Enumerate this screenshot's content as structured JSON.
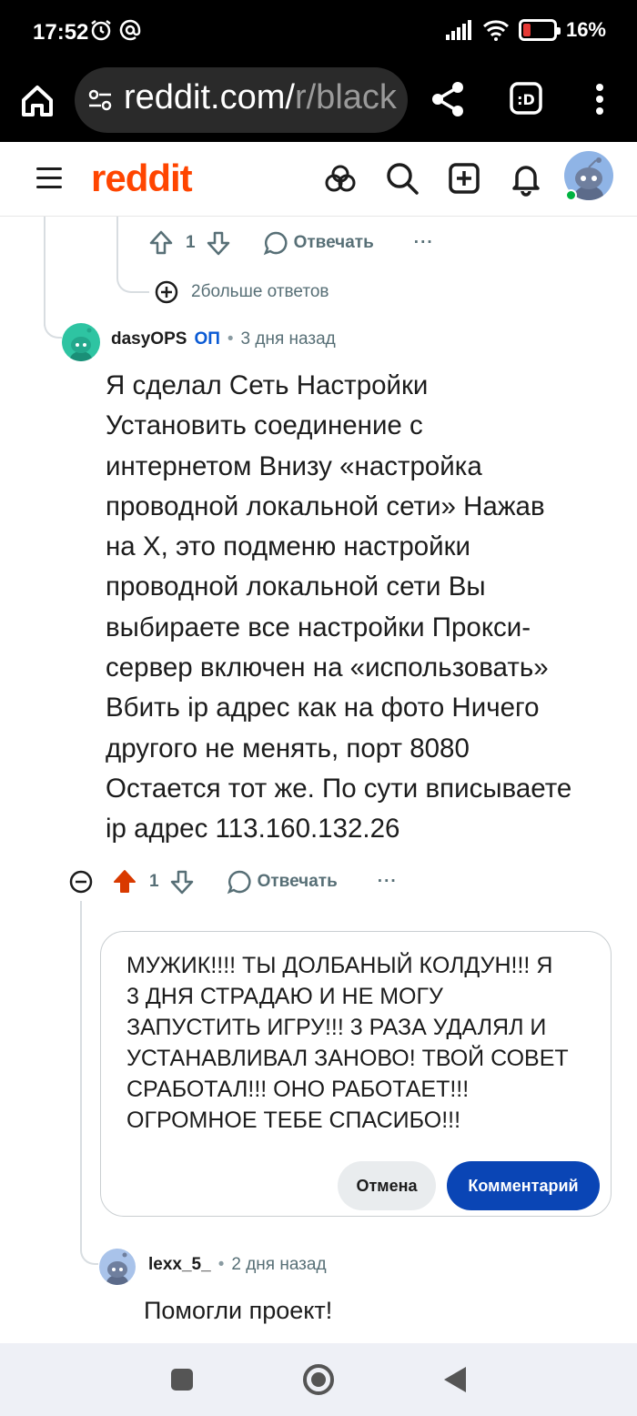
{
  "status": {
    "time": "17:52",
    "battery": "16%",
    "battery_level": 0.16
  },
  "browser": {
    "url_main": "reddit.com/",
    "url_dim": "r/black"
  },
  "header": {
    "logo": "reddit"
  },
  "prev_comment": {
    "votes": "1",
    "reply_label": "Отвечать",
    "more": "···",
    "more_replies": "2больше ответов"
  },
  "comment": {
    "author": "dasyOPS",
    "op_badge": "ОП",
    "separator": "•",
    "time": "3 дня назад",
    "lines": [
      "Я сделал Сеть  Настройки",
      "Установить соединение с",
      "интернетом Внизу «настройка",
      "проводной локальной сети» Нажав",
      "на Х, это подменю настройки",
      "проводной локальной сети Вы",
      "выбираете все настройки Прокси-",
      "сервер включен на «использовать»",
      "Вбить ip адрес как на фото Ничего",
      "другого не менять, порт 8080",
      "Остается тот же. По сути вписываете",
      "ip адрес 113.160.132.26"
    ],
    "votes": "1",
    "reply_label": "Отвечать",
    "more": "···"
  },
  "reply_box": {
    "lines": [
      "МУЖИК!!!! ТЫ ДОЛБАНЫЙ КОЛДУН!!! Я",
      "3 ДНЯ СТРАДАЮ И НЕ МОГУ",
      "ЗАПУСТИТЬ ИГРУ!!! 3 РАЗА УДАЛЯЛ И",
      "УСТАНАВЛИВАЛ ЗАНОВО! ТВОЙ СОВЕТ",
      "СРАБОТАЛ!!! ОНО РАБОТАЕТ!!!",
      "ОГРОМНОЕ ТЕБЕ СПАСИБО!!!"
    ],
    "cancel_label": "Отмена",
    "submit_label": "Комментарий"
  },
  "reply2": {
    "author": "lexx_5_",
    "separator": "•",
    "time": "2 дня назад",
    "body": "Помогли проект!"
  },
  "colors": {
    "brand": "#ff4500",
    "upvoted": "#d93a00",
    "primary_button": "#0a45b5",
    "op_badge": "#0a5ad4"
  }
}
